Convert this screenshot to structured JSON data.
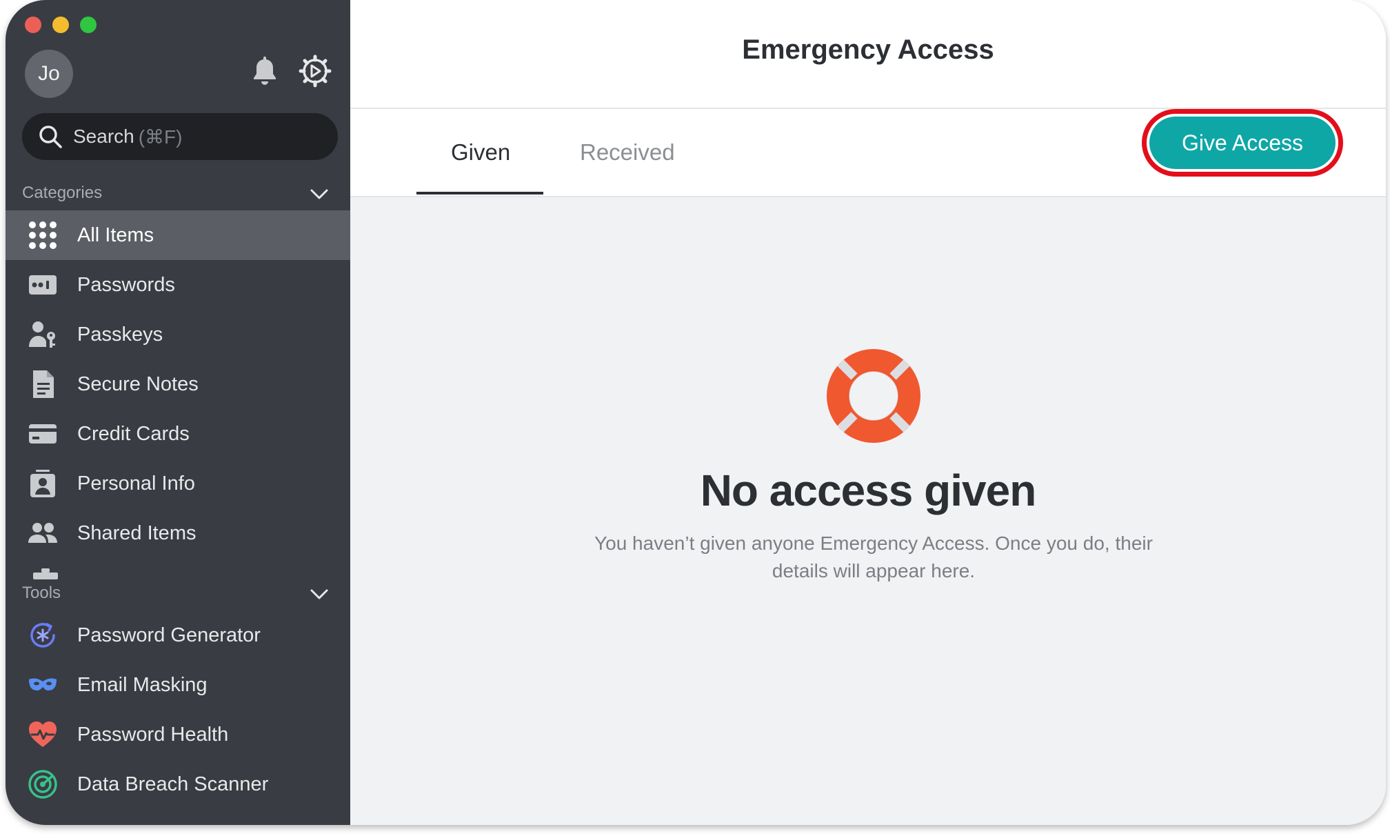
{
  "window": {
    "title": "Emergency Access"
  },
  "sidebar": {
    "avatar_initials": "Jo",
    "search": {
      "placeholder": "Search",
      "shortcut": "(⌘F)"
    },
    "categories_label": "Categories",
    "categories": [
      {
        "label": "All Items",
        "icon": "grid-icon",
        "active": true
      },
      {
        "label": "Passwords",
        "icon": "password-icon"
      },
      {
        "label": "Passkeys",
        "icon": "passkey-icon"
      },
      {
        "label": "Secure Notes",
        "icon": "note-icon"
      },
      {
        "label": "Credit Cards",
        "icon": "credit-card-icon"
      },
      {
        "label": "Personal Info",
        "icon": "id-card-icon"
      },
      {
        "label": "Shared Items",
        "icon": "people-icon"
      }
    ],
    "tools_label": "Tools",
    "tools": [
      {
        "label": "Password Generator",
        "icon": "password-generator-icon"
      },
      {
        "label": "Email Masking",
        "icon": "mask-icon"
      },
      {
        "label": "Password Health",
        "icon": "heart-pulse-icon"
      },
      {
        "label": "Data Breach Scanner",
        "icon": "radar-icon"
      }
    ]
  },
  "tabs": [
    {
      "label": "Given",
      "active": true
    },
    {
      "label": "Received",
      "active": false
    }
  ],
  "actions": {
    "give_access_label": "Give Access"
  },
  "empty_state": {
    "title": "No access given",
    "description": "You haven’t given anyone Emergency Access. Once you do, their details will appear here.",
    "icon": "lifebuoy-icon"
  },
  "colors": {
    "sidebar_bg": "#393c43",
    "accent": "#0ea7a5",
    "highlight_ring": "#e20f1b",
    "lifebuoy": "#f0582f"
  }
}
